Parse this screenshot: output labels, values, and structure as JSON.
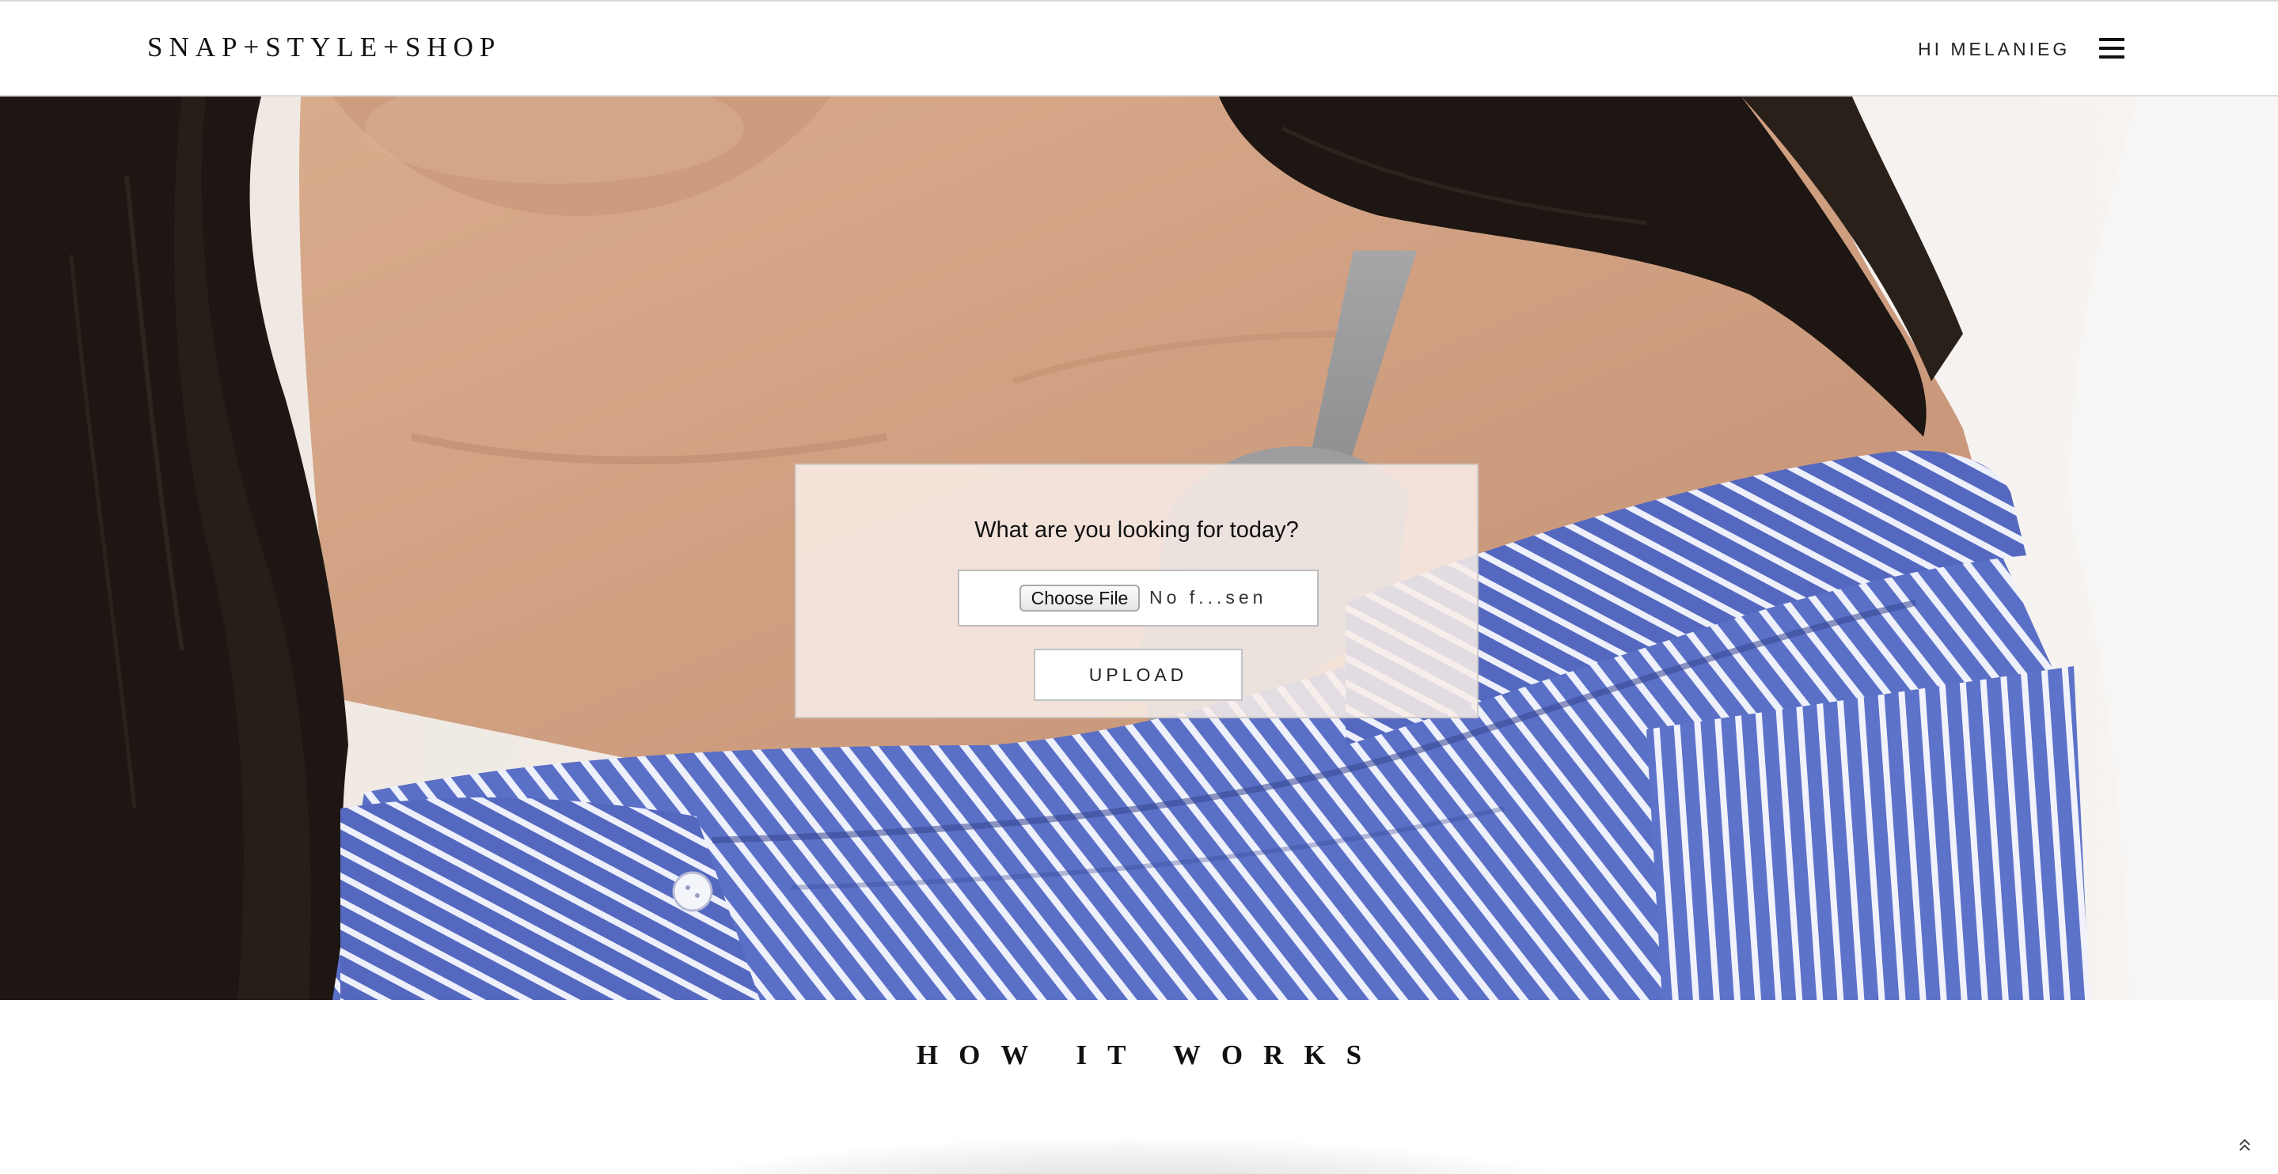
{
  "header": {
    "logo": "SNAP+STYLE+SHOP",
    "greeting": "HI MELANIEG",
    "menu_icon": "hamburger-menu-icon"
  },
  "hero": {
    "image_description_icon": "hero-photo",
    "colors": {
      "skin": "#d4a689",
      "hair": "#1c1511",
      "shirt_blue": "#5a6fc6",
      "shirt_stripe": "#eef0fb",
      "bra_gray": "#9a9a9c"
    },
    "search": {
      "question": "What are you looking for today?",
      "choose_file_label": "Choose File",
      "file_status": "No f...sen",
      "upload_label": "UPLOAD"
    }
  },
  "how_it_works": {
    "title": "HOW IT WORKS"
  },
  "scroll_top_icon": "double-chevron-up-icon"
}
